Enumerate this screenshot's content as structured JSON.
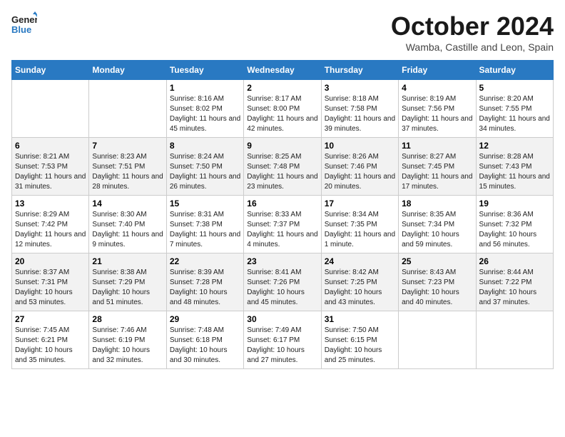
{
  "header": {
    "logo_line1": "General",
    "logo_line2": "Blue",
    "month": "October 2024",
    "location": "Wamba, Castille and Leon, Spain"
  },
  "days_of_week": [
    "Sunday",
    "Monday",
    "Tuesday",
    "Wednesday",
    "Thursday",
    "Friday",
    "Saturday"
  ],
  "weeks": [
    [
      {
        "day": "",
        "sunrise": "",
        "sunset": "",
        "daylight": ""
      },
      {
        "day": "",
        "sunrise": "",
        "sunset": "",
        "daylight": ""
      },
      {
        "day": "1",
        "sunrise": "Sunrise: 8:16 AM",
        "sunset": "Sunset: 8:02 PM",
        "daylight": "Daylight: 11 hours and 45 minutes."
      },
      {
        "day": "2",
        "sunrise": "Sunrise: 8:17 AM",
        "sunset": "Sunset: 8:00 PM",
        "daylight": "Daylight: 11 hours and 42 minutes."
      },
      {
        "day": "3",
        "sunrise": "Sunrise: 8:18 AM",
        "sunset": "Sunset: 7:58 PM",
        "daylight": "Daylight: 11 hours and 39 minutes."
      },
      {
        "day": "4",
        "sunrise": "Sunrise: 8:19 AM",
        "sunset": "Sunset: 7:56 PM",
        "daylight": "Daylight: 11 hours and 37 minutes."
      },
      {
        "day": "5",
        "sunrise": "Sunrise: 8:20 AM",
        "sunset": "Sunset: 7:55 PM",
        "daylight": "Daylight: 11 hours and 34 minutes."
      }
    ],
    [
      {
        "day": "6",
        "sunrise": "Sunrise: 8:21 AM",
        "sunset": "Sunset: 7:53 PM",
        "daylight": "Daylight: 11 hours and 31 minutes."
      },
      {
        "day": "7",
        "sunrise": "Sunrise: 8:23 AM",
        "sunset": "Sunset: 7:51 PM",
        "daylight": "Daylight: 11 hours and 28 minutes."
      },
      {
        "day": "8",
        "sunrise": "Sunrise: 8:24 AM",
        "sunset": "Sunset: 7:50 PM",
        "daylight": "Daylight: 11 hours and 26 minutes."
      },
      {
        "day": "9",
        "sunrise": "Sunrise: 8:25 AM",
        "sunset": "Sunset: 7:48 PM",
        "daylight": "Daylight: 11 hours and 23 minutes."
      },
      {
        "day": "10",
        "sunrise": "Sunrise: 8:26 AM",
        "sunset": "Sunset: 7:46 PM",
        "daylight": "Daylight: 11 hours and 20 minutes."
      },
      {
        "day": "11",
        "sunrise": "Sunrise: 8:27 AM",
        "sunset": "Sunset: 7:45 PM",
        "daylight": "Daylight: 11 hours and 17 minutes."
      },
      {
        "day": "12",
        "sunrise": "Sunrise: 8:28 AM",
        "sunset": "Sunset: 7:43 PM",
        "daylight": "Daylight: 11 hours and 15 minutes."
      }
    ],
    [
      {
        "day": "13",
        "sunrise": "Sunrise: 8:29 AM",
        "sunset": "Sunset: 7:42 PM",
        "daylight": "Daylight: 11 hours and 12 minutes."
      },
      {
        "day": "14",
        "sunrise": "Sunrise: 8:30 AM",
        "sunset": "Sunset: 7:40 PM",
        "daylight": "Daylight: 11 hours and 9 minutes."
      },
      {
        "day": "15",
        "sunrise": "Sunrise: 8:31 AM",
        "sunset": "Sunset: 7:38 PM",
        "daylight": "Daylight: 11 hours and 7 minutes."
      },
      {
        "day": "16",
        "sunrise": "Sunrise: 8:33 AM",
        "sunset": "Sunset: 7:37 PM",
        "daylight": "Daylight: 11 hours and 4 minutes."
      },
      {
        "day": "17",
        "sunrise": "Sunrise: 8:34 AM",
        "sunset": "Sunset: 7:35 PM",
        "daylight": "Daylight: 11 hours and 1 minute."
      },
      {
        "day": "18",
        "sunrise": "Sunrise: 8:35 AM",
        "sunset": "Sunset: 7:34 PM",
        "daylight": "Daylight: 10 hours and 59 minutes."
      },
      {
        "day": "19",
        "sunrise": "Sunrise: 8:36 AM",
        "sunset": "Sunset: 7:32 PM",
        "daylight": "Daylight: 10 hours and 56 minutes."
      }
    ],
    [
      {
        "day": "20",
        "sunrise": "Sunrise: 8:37 AM",
        "sunset": "Sunset: 7:31 PM",
        "daylight": "Daylight: 10 hours and 53 minutes."
      },
      {
        "day": "21",
        "sunrise": "Sunrise: 8:38 AM",
        "sunset": "Sunset: 7:29 PM",
        "daylight": "Daylight: 10 hours and 51 minutes."
      },
      {
        "day": "22",
        "sunrise": "Sunrise: 8:39 AM",
        "sunset": "Sunset: 7:28 PM",
        "daylight": "Daylight: 10 hours and 48 minutes."
      },
      {
        "day": "23",
        "sunrise": "Sunrise: 8:41 AM",
        "sunset": "Sunset: 7:26 PM",
        "daylight": "Daylight: 10 hours and 45 minutes."
      },
      {
        "day": "24",
        "sunrise": "Sunrise: 8:42 AM",
        "sunset": "Sunset: 7:25 PM",
        "daylight": "Daylight: 10 hours and 43 minutes."
      },
      {
        "day": "25",
        "sunrise": "Sunrise: 8:43 AM",
        "sunset": "Sunset: 7:23 PM",
        "daylight": "Daylight: 10 hours and 40 minutes."
      },
      {
        "day": "26",
        "sunrise": "Sunrise: 8:44 AM",
        "sunset": "Sunset: 7:22 PM",
        "daylight": "Daylight: 10 hours and 37 minutes."
      }
    ],
    [
      {
        "day": "27",
        "sunrise": "Sunrise: 7:45 AM",
        "sunset": "Sunset: 6:21 PM",
        "daylight": "Daylight: 10 hours and 35 minutes."
      },
      {
        "day": "28",
        "sunrise": "Sunrise: 7:46 AM",
        "sunset": "Sunset: 6:19 PM",
        "daylight": "Daylight: 10 hours and 32 minutes."
      },
      {
        "day": "29",
        "sunrise": "Sunrise: 7:48 AM",
        "sunset": "Sunset: 6:18 PM",
        "daylight": "Daylight: 10 hours and 30 minutes."
      },
      {
        "day": "30",
        "sunrise": "Sunrise: 7:49 AM",
        "sunset": "Sunset: 6:17 PM",
        "daylight": "Daylight: 10 hours and 27 minutes."
      },
      {
        "day": "31",
        "sunrise": "Sunrise: 7:50 AM",
        "sunset": "Sunset: 6:15 PM",
        "daylight": "Daylight: 10 hours and 25 minutes."
      },
      {
        "day": "",
        "sunrise": "",
        "sunset": "",
        "daylight": ""
      },
      {
        "day": "",
        "sunrise": "",
        "sunset": "",
        "daylight": ""
      }
    ]
  ]
}
